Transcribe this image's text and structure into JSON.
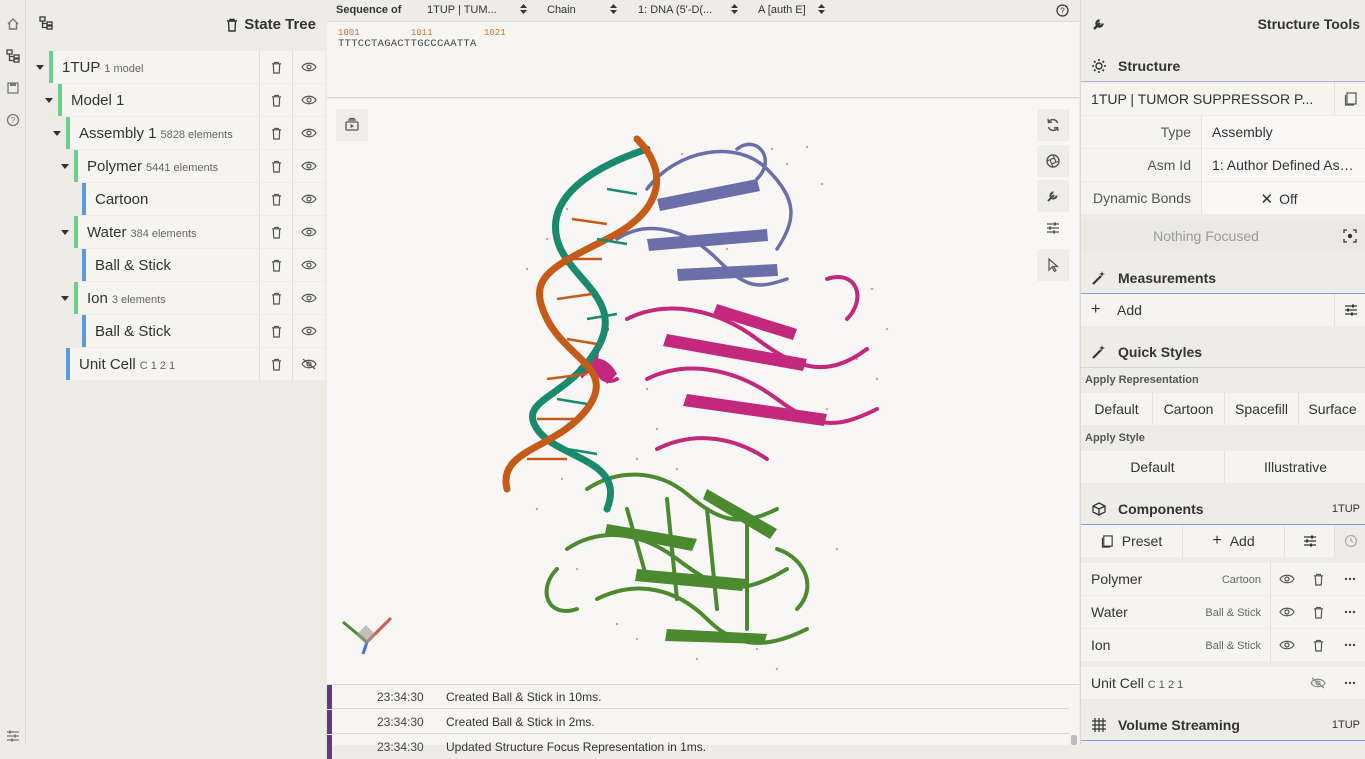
{
  "left_strip": {
    "icons": [
      "home-icon",
      "tree-icon",
      "save-icon",
      "help-icon",
      "settings-icon"
    ]
  },
  "state_tree": {
    "title": "State Tree",
    "nodes": [
      {
        "label": "1TUP",
        "sub": "1 model"
      },
      {
        "label": "Model 1",
        "sub": ""
      },
      {
        "label": "Assembly 1",
        "sub": "5828 elements"
      },
      {
        "label": "Polymer",
        "sub": "5441 elements"
      },
      {
        "label": "Cartoon",
        "sub": ""
      },
      {
        "label": "Water",
        "sub": "384 elements"
      },
      {
        "label": "Ball & Stick",
        "sub": ""
      },
      {
        "label": "Ion",
        "sub": "3 elements"
      },
      {
        "label": "Ball & Stick",
        "sub": ""
      },
      {
        "label": "Unit Cell",
        "sub": "C 1 2 1"
      }
    ]
  },
  "sequence": {
    "label": "Sequence of",
    "structure": "1TUP | TUM...",
    "mode": "Chain",
    "entity": "1: DNA (5'-D(...",
    "chain": "A [auth E]",
    "numbers": [
      "1001",
      "1011",
      "1021"
    ],
    "residues": "TTTCCTAGACTTGCCCAATTA"
  },
  "log": [
    {
      "time": "23:34:30",
      "message": "Created Ball & Stick in 10ms."
    },
    {
      "time": "23:34:30",
      "message": "Created Ball & Stick in 2ms."
    },
    {
      "time": "23:34:30",
      "message": "Updated Structure Focus Representation in 1ms."
    }
  ],
  "structure_tools": {
    "title": "Structure Tools",
    "structure": {
      "title": "Structure",
      "name": "1TUP | TUMOR SUPPRESSOR P...",
      "type_label": "Type",
      "type_value": "Assembly",
      "asm_label": "Asm Id",
      "asm_value": "1: Author Defined Ass...",
      "bonds_label": "Dynamic Bonds",
      "bonds_value": "Off",
      "focus": "Nothing Focused"
    },
    "measurements": {
      "title": "Measurements",
      "add": "Add"
    },
    "quick_styles": {
      "title": "Quick Styles",
      "apply_rep": "Apply Representation",
      "reps": [
        "Default",
        "Cartoon",
        "Spacefill",
        "Surface"
      ],
      "apply_style": "Apply Style",
      "styles": [
        "Default",
        "Illustrative"
      ]
    },
    "components": {
      "title": "Components",
      "id": "1TUP",
      "preset": "Preset",
      "add": "Add",
      "items": [
        {
          "name": "Polymer",
          "rep": "Cartoon"
        },
        {
          "name": "Water",
          "rep": "Ball & Stick"
        },
        {
          "name": "Ion",
          "rep": "Ball & Stick"
        }
      ],
      "unit_cell": "Unit Cell",
      "unit_cell_sub": "C 1 2 1"
    },
    "volume": {
      "title": "Volume Streaming",
      "id": "1TUP"
    }
  },
  "colors": {
    "accent_green": "#6ccf8f",
    "accent_blue": "#5c9bd6",
    "log_marker": "#5b3a86",
    "ribbon_teal": "#1a8a6e",
    "ribbon_orange": "#c65a17",
    "ribbon_purple": "#6b6ea8",
    "ribbon_magenta": "#c4287c",
    "ribbon_green": "#4b8a2e"
  }
}
